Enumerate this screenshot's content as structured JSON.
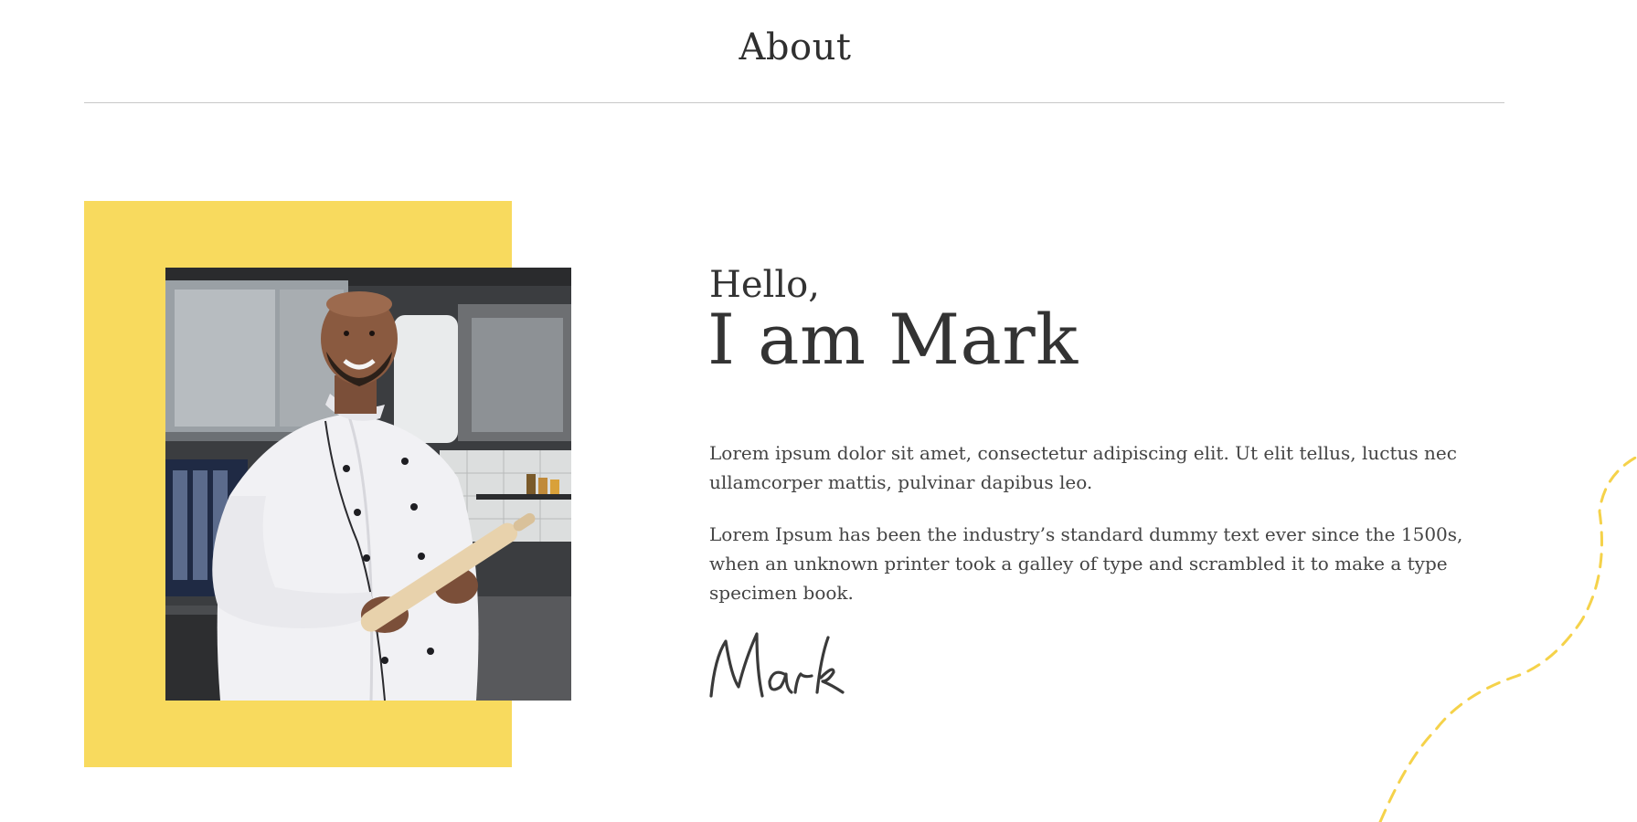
{
  "section": {
    "title": "About"
  },
  "intro": {
    "greeting": "Hello,",
    "name_heading": "I am Mark"
  },
  "bio": {
    "paragraph_1": "Lorem ipsum dolor sit amet, consectetur adipiscing elit. Ut elit tellus, luctus nec ullamcorper mattis, pulvinar dapibus leo.",
    "paragraph_2": " Lorem Ipsum has been the industry’s standard dummy text ever since the 1500s, when an unknown printer took a galley of type and scrambled it to make a type specimen book."
  },
  "signature": {
    "text": "Mark"
  },
  "photo": {
    "subject": "smiling chef in white chef jacket holding a rolling pin in a kitchen"
  },
  "colors": {
    "accent_yellow": "#f8da5e",
    "text_dark": "#333333",
    "divider": "#c8c8c8",
    "squiggle": "#f5d24a"
  },
  "icons": {
    "decoration": "dashed-squiggle-line"
  }
}
